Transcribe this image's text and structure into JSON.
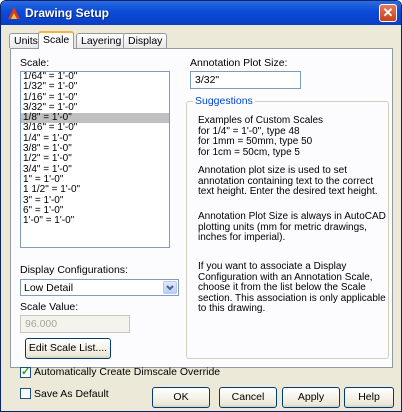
{
  "window": {
    "title": "Drawing Setup",
    "close_glyph": "✕"
  },
  "tabs": [
    {
      "label": "Units"
    },
    {
      "label": "Scale"
    },
    {
      "label": "Layering"
    },
    {
      "label": "Display"
    }
  ],
  "scale": {
    "label": "Scale:",
    "items": [
      "1/64\" = 1'-0\"",
      "1/32\" = 1'-0\"",
      "1/16\" = 1'-0\"",
      "3/32\" = 1'-0\"",
      "1/8\" = 1'-0\"",
      "3/16\" = 1'-0\"",
      "1/4\" = 1'-0\"",
      "3/8\" = 1'-0\"",
      "1/2\" = 1'-0\"",
      "3/4\" = 1'-0\"",
      "1\" = 1'-0\"",
      "1 1/2\" = 1'-0\"",
      "3\" = 1'-0\"",
      "6\" = 1'-0\"",
      "1'-0\" = 1'-0\""
    ],
    "selected": "1/8\" = 1'-0\""
  },
  "display_config": {
    "label": "Display Configurations:",
    "value": "Low Detail"
  },
  "scale_value": {
    "label": "Scale Value:",
    "value": "96.000"
  },
  "edit_scale_button": "Edit Scale List....",
  "auto_dimscale": {
    "label": "Automatically Create Dimscale Override",
    "checked": true
  },
  "annotation": {
    "label": "Annotation Plot Size:",
    "value": "3/32\""
  },
  "suggestions": {
    "title": "Suggestions",
    "p1": "Examples of Custom Scales\n        for 1/4\" = 1'-0\", type 48\n        for 1mm = 50mm, type 50\n        for 1cm = 50cm, type 5",
    "p2": "Annotation plot size is used to set annotation containing text to the correct text height. Enter the desired text height.",
    "p3": "Annotation Plot Size is always in AutoCAD plotting units (mm for metric drawings, inches for imperial).",
    "p4": "If you want to associate a Display Configuration with an Annotation Scale, choose it from the list below the Scale section. This association is only applicable to this drawing."
  },
  "footer": {
    "save_default": {
      "label": "Save As Default",
      "checked": false
    },
    "ok": "OK",
    "cancel": "Cancel",
    "apply": "Apply",
    "help": "Help"
  },
  "colors": {
    "title_bar": "#0b4ad8",
    "accent": "#0046d5",
    "tab_highlight": "#f7b43b"
  }
}
